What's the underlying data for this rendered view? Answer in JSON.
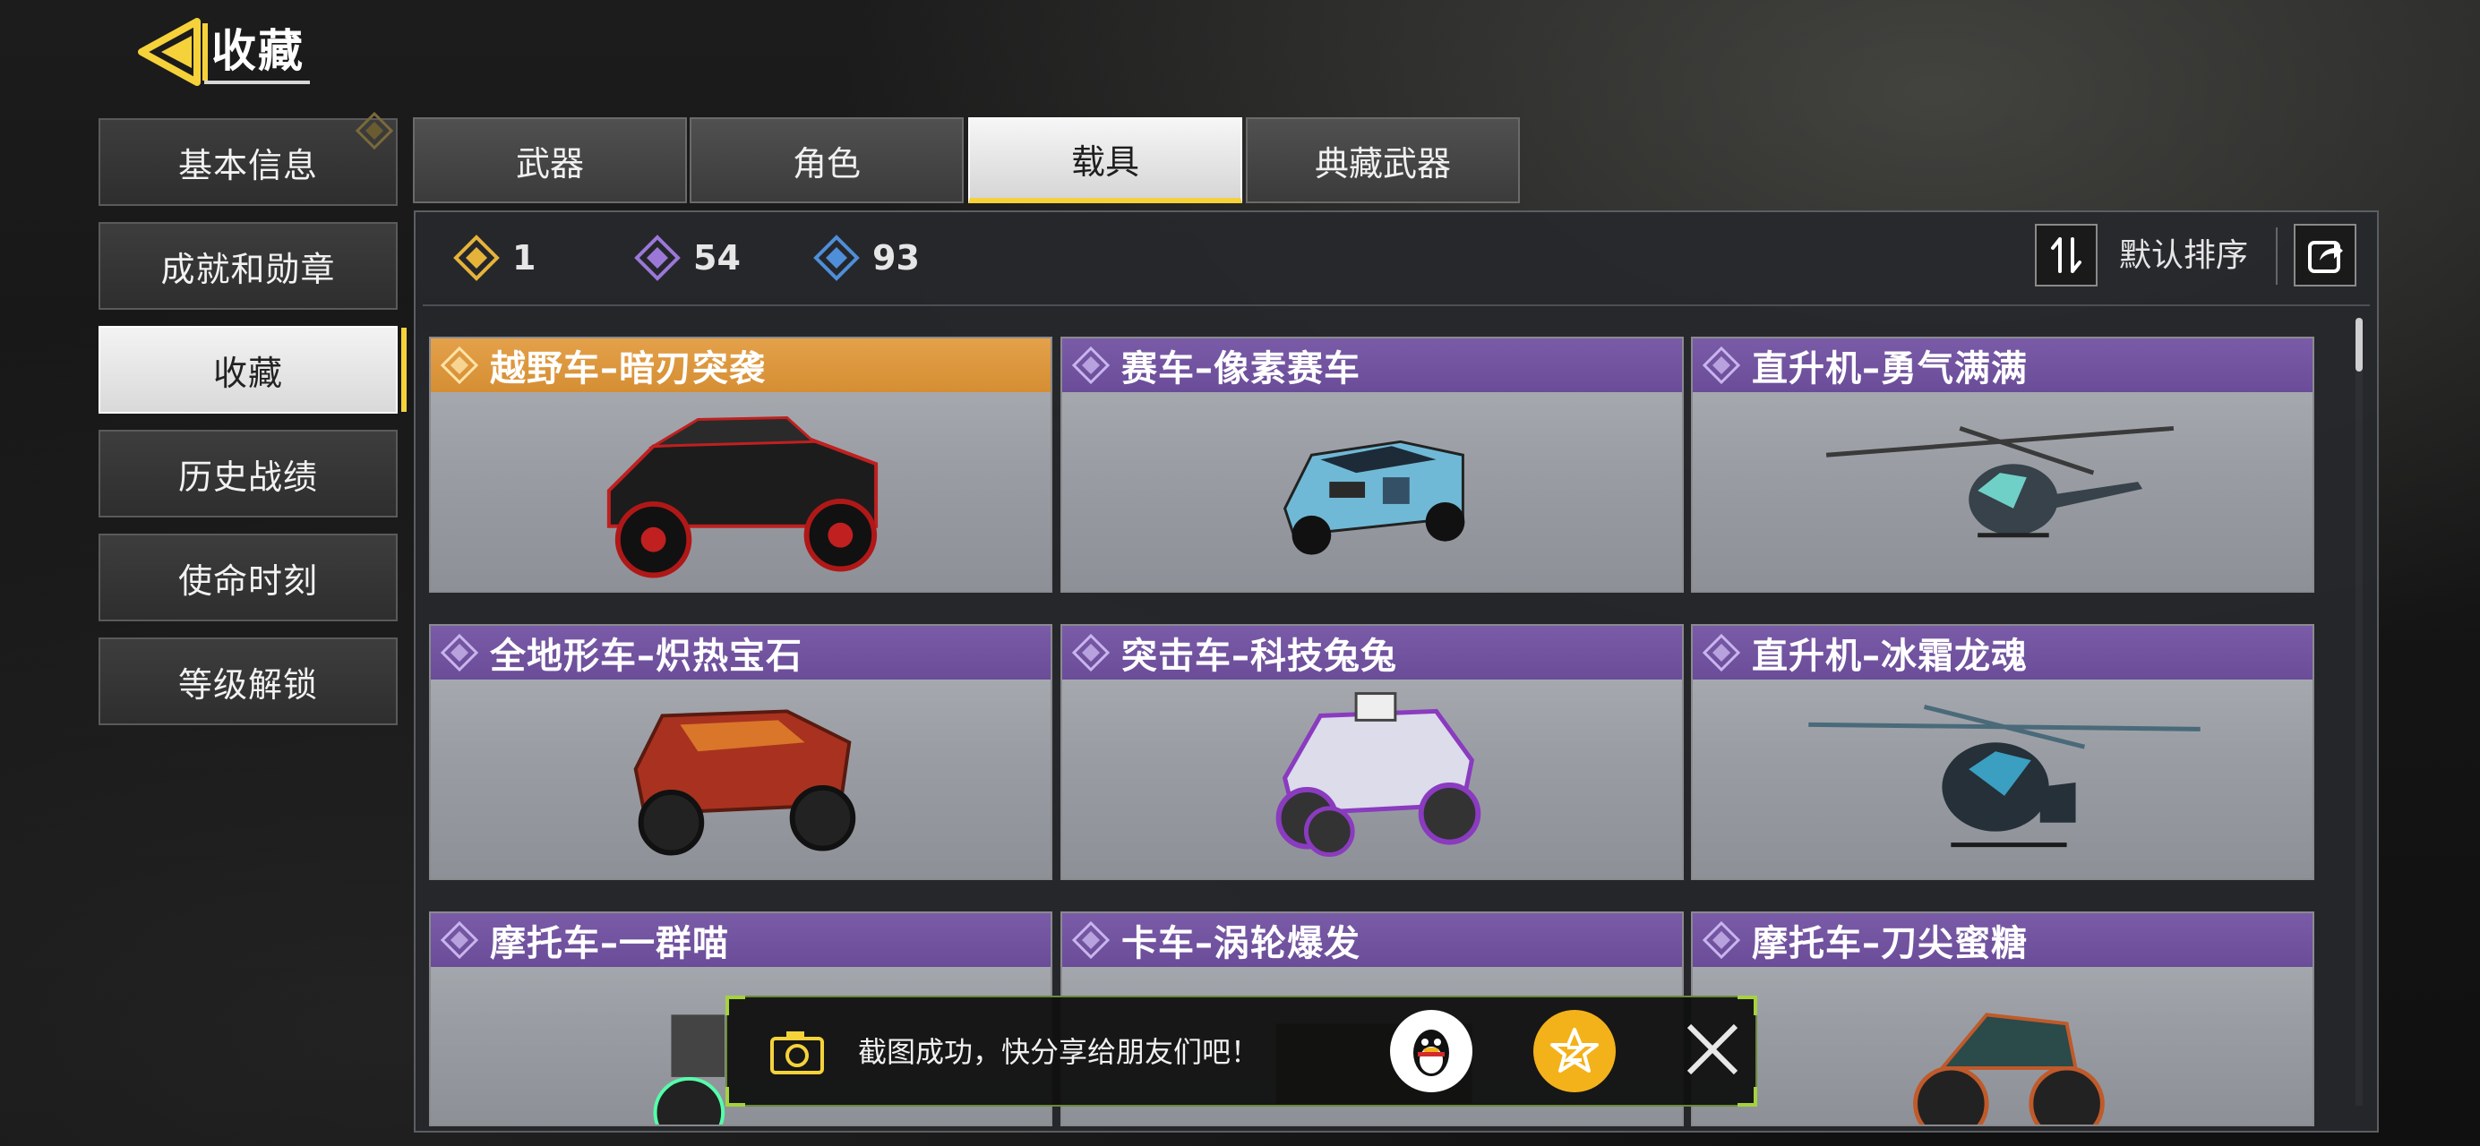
{
  "header": {
    "title": "收藏",
    "back_icon": "back-arrow-icon"
  },
  "sidebar": {
    "items": [
      {
        "label": "基本信息",
        "active": false
      },
      {
        "label": "成就和勋章",
        "active": false
      },
      {
        "label": "收藏",
        "active": true
      },
      {
        "label": "历史战绩",
        "active": false
      },
      {
        "label": "使命时刻",
        "active": false
      },
      {
        "label": "等级解锁",
        "active": false
      }
    ]
  },
  "tabs": [
    {
      "label": "武器",
      "active": false
    },
    {
      "label": "角色",
      "active": false
    },
    {
      "label": "载具",
      "active": true
    },
    {
      "label": "典藏武器",
      "active": false
    }
  ],
  "counts": [
    {
      "rarity": "legendary",
      "value": "1",
      "color": "#e6b33a"
    },
    {
      "rarity": "epic",
      "value": "54",
      "color": "#9b78d8"
    },
    {
      "rarity": "rare",
      "value": "93",
      "color": "#4f8ed8"
    }
  ],
  "sort": {
    "label": "默认排序",
    "sort_icon": "sort-icon",
    "share_icon": "share-icon"
  },
  "cards": [
    {
      "title": "越野车–暗刃突袭",
      "rarity": "gold"
    },
    {
      "title": "赛车–像素赛车",
      "rarity": "purple"
    },
    {
      "title": "直升机–勇气满满",
      "rarity": "purple"
    },
    {
      "title": "全地形车–炽热宝石",
      "rarity": "purple"
    },
    {
      "title": "突击车–科技兔兔",
      "rarity": "purple"
    },
    {
      "title": "直升机–冰霜龙魂",
      "rarity": "purple"
    },
    {
      "title": "摩托车–一群喵",
      "rarity": "purple"
    },
    {
      "title": "卡车–涡轮爆发",
      "rarity": "purple"
    },
    {
      "title": "摩托车–刀尖蜜糖",
      "rarity": "purple"
    }
  ],
  "toast": {
    "message": "截图成功，快分享给朋友们吧！",
    "camera_icon": "camera-icon",
    "qq_icon": "qq-penguin-icon",
    "qzone_icon": "qzone-star-icon",
    "close_icon": "close-icon"
  }
}
